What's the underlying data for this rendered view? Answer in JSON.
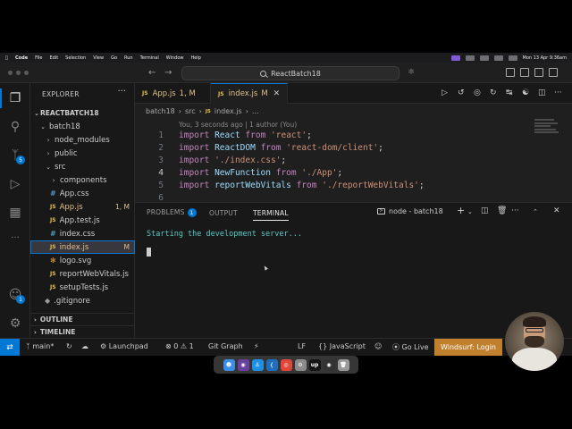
{
  "menubar": {
    "items": [
      "Code",
      "File",
      "Edit",
      "Selection",
      "View",
      "Go",
      "Run",
      "Terminal",
      "Window",
      "Help"
    ],
    "clock": "Mon 13 Apr  9:36am"
  },
  "titlebar": {
    "search_text": "ReactBatch18"
  },
  "activity": {
    "scm_badge": "5",
    "accounts_badge": "1"
  },
  "explorer": {
    "title": "EXPLORER",
    "more": "···",
    "root": "REACTBATCH18",
    "items": [
      {
        "label": "batch18"
      },
      {
        "label": "node_modules"
      },
      {
        "label": "public"
      },
      {
        "label": "src"
      },
      {
        "label": "components"
      },
      {
        "label": "App.css"
      },
      {
        "label": "App.js",
        "badge": "1, M"
      },
      {
        "label": "App.test.js"
      },
      {
        "label": "index.css"
      },
      {
        "label": "index.js",
        "badge": "M"
      },
      {
        "label": "logo.svg"
      },
      {
        "label": "reportWebVitals.js"
      },
      {
        "label": "setupTests.js"
      },
      {
        "label": ".gitignore"
      }
    ],
    "outline": "OUTLINE",
    "timeline": "TIMELINE",
    "js_glyph": "JS"
  },
  "tabs": [
    {
      "label": "App.js",
      "badge": "1, M"
    },
    {
      "label": "index.js",
      "badge": "M"
    }
  ],
  "breadcrumb": [
    "batch18",
    "src",
    "index.js",
    "..."
  ],
  "codelens": "You, 3 seconds ago | 1 author (You)",
  "code": {
    "lines": [
      {
        "n": "1",
        "kw": "import",
        "id": "React",
        "from": "from",
        "str": "'react'",
        "end": ";"
      },
      {
        "n": "2",
        "kw": "import",
        "id": "ReactDOM",
        "from": "from",
        "str": "'react-dom/client'",
        "end": ";"
      },
      {
        "n": "3",
        "kw": "import",
        "id": "",
        "from": "",
        "str": "'./index.css'",
        "end": ";"
      },
      {
        "n": "4",
        "kw": "import",
        "id": "NewFunction",
        "from": "from",
        "str": "'./App'",
        "end": ";"
      },
      {
        "n": "5",
        "kw": "import",
        "id": "reportWebVitals",
        "from": "from",
        "str": "'./reportWebVitals'",
        "end": ";"
      },
      {
        "n": "6",
        "kw": "",
        "id": "",
        "from": "",
        "str": "",
        "end": ""
      }
    ]
  },
  "panel": {
    "tabs": [
      "PROBLEMS",
      "OUTPUT",
      "TERMINAL"
    ],
    "problems_badge": "1",
    "terminal_name": "node - batch18",
    "output": "Starting the development server..."
  },
  "statusbar": {
    "branch": "main*",
    "launchpad": "Launchpad",
    "errors": "0",
    "warnings": "1",
    "gitgraph": "Git Graph",
    "eol": "LF",
    "language": "JavaScript",
    "golive": "Go Live",
    "windsurf": "Windsurf: Login"
  },
  "dock": {
    "icons": [
      "finder-icon",
      "github-icon",
      "docker-icon",
      "vscode-icon",
      "chrome-icon",
      "settings-icon",
      "upwork-icon",
      "obs-icon",
      "trash-icon"
    ],
    "upwork_glyph": "up"
  }
}
